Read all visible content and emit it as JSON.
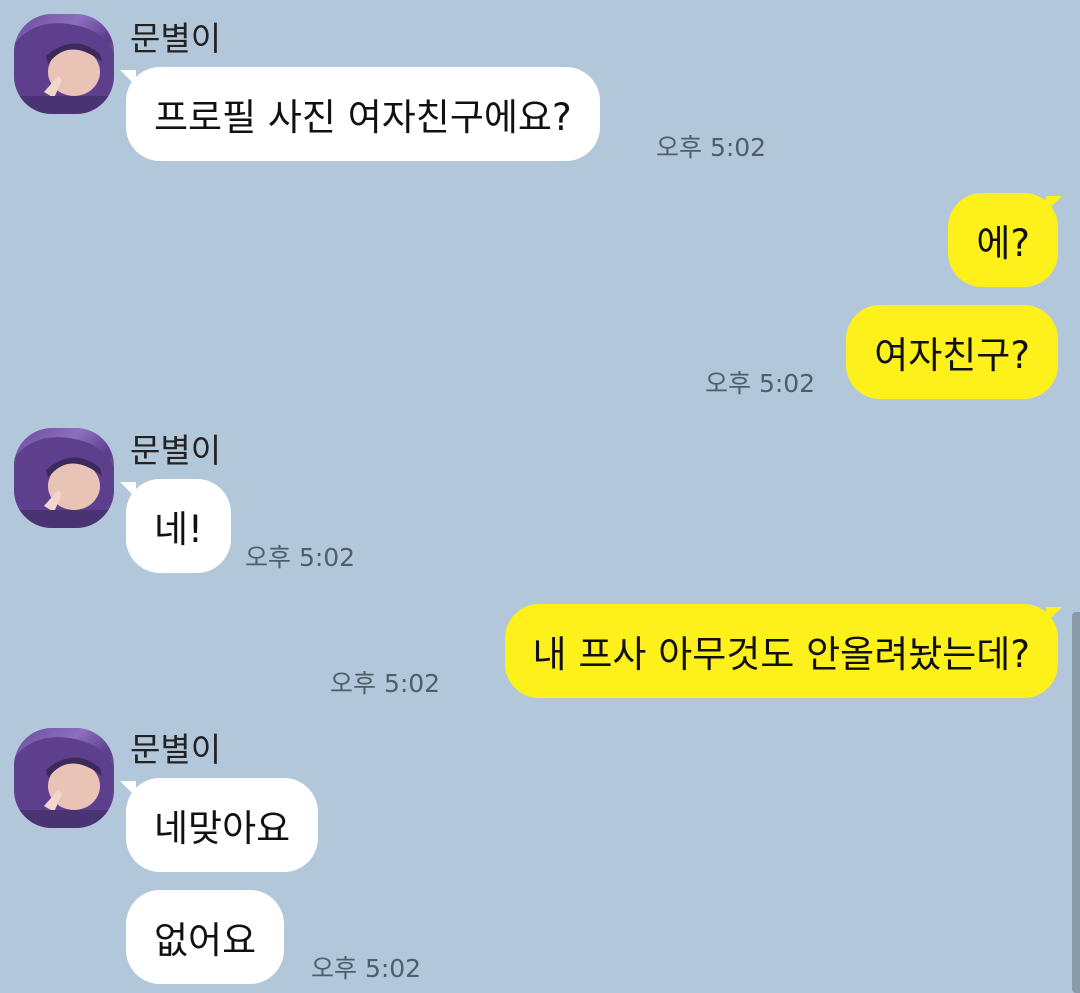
{
  "colors": {
    "background": "#b2c7d9",
    "incoming_bubble": "#ffffff",
    "outgoing_bubble": "#fef01b",
    "timestamp": "#4f5e6b"
  },
  "sender_name": "문별이",
  "messages": [
    {
      "direction": "in",
      "text": "프로필 사진 여자친구에요?",
      "time": "오후 5:02"
    },
    {
      "direction": "out",
      "text": "에?",
      "time": ""
    },
    {
      "direction": "out",
      "text": "여자친구?",
      "time": "오후 5:02"
    },
    {
      "direction": "in",
      "text": "네!",
      "time": "오후 5:02"
    },
    {
      "direction": "out",
      "text": "내 프사 아무것도 안올려놨는데?",
      "time": "오후 5:02"
    },
    {
      "direction": "in",
      "text": "네맞아요",
      "time": ""
    },
    {
      "direction": "in",
      "text": "없어요",
      "time": "오후 5:02"
    }
  ]
}
